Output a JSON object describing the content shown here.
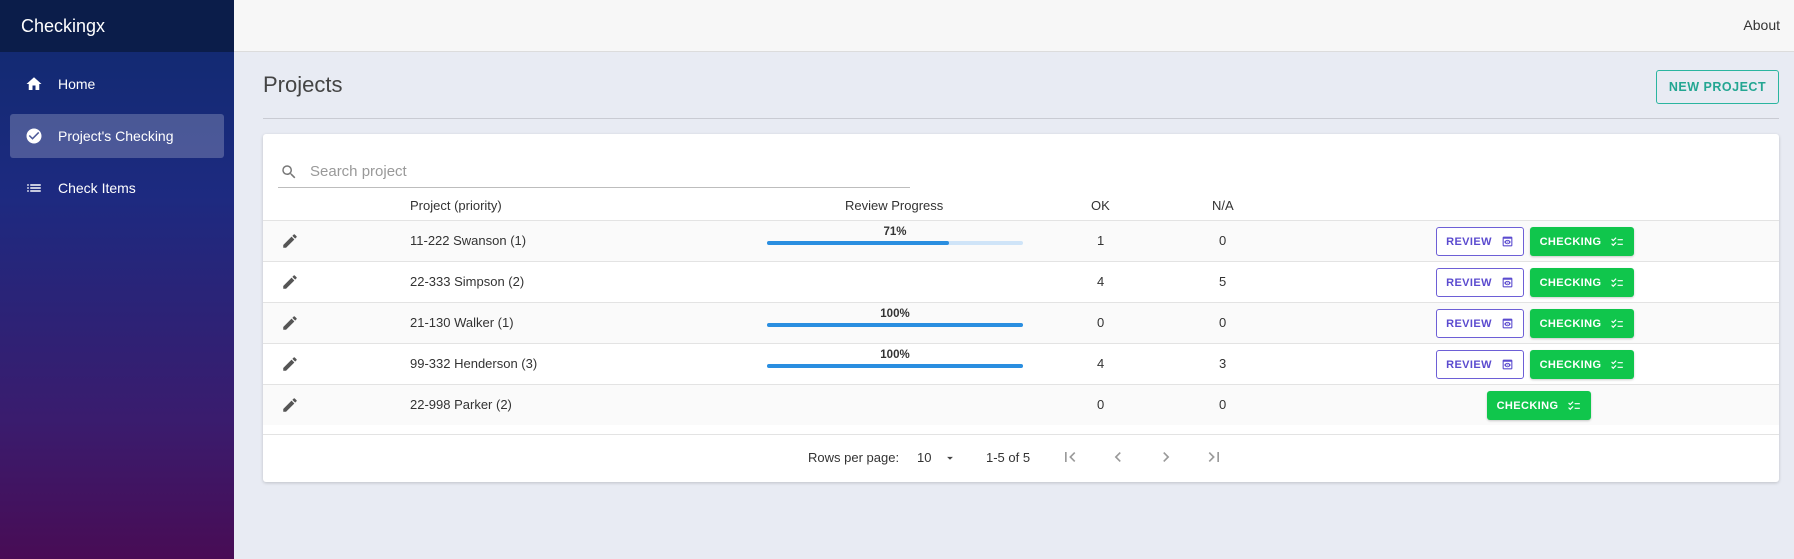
{
  "app": {
    "title": "Checkingx"
  },
  "sidebar": {
    "items": [
      {
        "label": "Home",
        "icon": "home-icon"
      },
      {
        "label": "Project's Checking",
        "icon": "check-circle-icon",
        "active": true
      },
      {
        "label": "Check Items",
        "icon": "list-icon"
      }
    ]
  },
  "topbar": {
    "about_label": "About"
  },
  "page": {
    "title": "Projects",
    "new_project_label": "NEW PROJECT"
  },
  "search": {
    "placeholder": "Search project",
    "value": ""
  },
  "table": {
    "headers": {
      "project": "Project (priority)",
      "progress": "Review Progress",
      "ok": "OK",
      "na": "N/A"
    },
    "rows": [
      {
        "project": "11-222 Swanson (1)",
        "progress_label": "71%",
        "progress": 0.71,
        "ok": "1",
        "na": "0",
        "review_label": "REVIEW",
        "checking_label": "CHECKING"
      },
      {
        "project": "22-333 Simpson (2)",
        "progress_label": "",
        "progress": null,
        "ok": "4",
        "na": "5",
        "review_label": "REVIEW",
        "checking_label": "CHECKING"
      },
      {
        "project": "21-130 Walker (1)",
        "progress_label": "100%",
        "progress": 1.0,
        "ok": "0",
        "na": "0",
        "review_label": "REVIEW",
        "checking_label": "CHECKING"
      },
      {
        "project": "99-332 Henderson (3)",
        "progress_label": "100%",
        "progress": 1.0,
        "ok": "4",
        "na": "3",
        "review_label": "REVIEW",
        "checking_label": "CHECKING"
      },
      {
        "project": "22-998 Parker (2)",
        "progress_label": "",
        "progress": null,
        "ok": "0",
        "na": "0",
        "review_label": "",
        "checking_label": "CHECKING"
      }
    ]
  },
  "pagination": {
    "rows_per_page_label": "Rows per page:",
    "rows_per_page": "10",
    "range": "1-5 of 5"
  },
  "colors": {
    "accent_teal": "#23a692",
    "review_purple": "#5b4bcf",
    "checking_green": "#10c64c",
    "progress_blue": "#2a8ee0"
  }
}
